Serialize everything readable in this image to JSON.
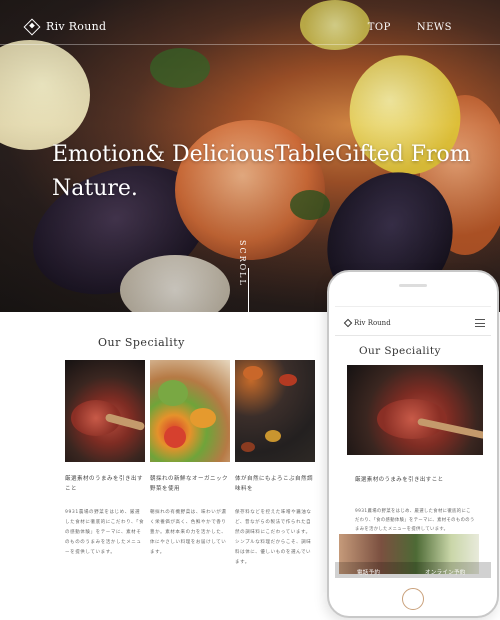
{
  "brand": {
    "name": "Riv Round"
  },
  "nav": {
    "items": [
      "TOP",
      "NEWS"
    ]
  },
  "hero": {
    "tagline": "Emotion& DeliciousTableGifted From Nature.",
    "scroll_label": "SCROLL"
  },
  "speciality": {
    "title": "Our Speciality",
    "cards": [
      {
        "heading": "厳選素材のうまみを引き出すこと",
        "body": "9931農場の野菜をはじめ、厳選した食材に徹底的にこだわり、「食の感動体験」をテーマに、素材そのもののうまみを活かしたメニューを提供しています。"
      },
      {
        "heading": "朝採れの新鮮なオーガニック野菜を使用",
        "body": "朝採れの有機野菜は、味わいが濃く栄養価が高く、色鮮やかで香り豊か。素材本来の力を活かした、体にやさしい料理をお届けしています。"
      },
      {
        "heading": "体が自然にもよろこぶ自然調味料を",
        "body": "保存料などを控えた味噌や醤油など、昔ながらの製法で作られた自然の調味料にこだわっています。シンプルな料理だからこそ、調味料は体に、優しいものを選んでいます。"
      }
    ]
  },
  "mobile": {
    "brand": "Riv Round",
    "title": "Our Speciality",
    "heading": "厳選素材のうまみを引き出すこと",
    "body": "9931農場の野菜をはじめ、厳選した食材に徹底的にこだわり、「食の感動体験」をテーマに、素材そのもののうまみを活かしたメニューを提供しています。",
    "footer_left": "電話予約",
    "footer_right": "オンライン予約"
  }
}
